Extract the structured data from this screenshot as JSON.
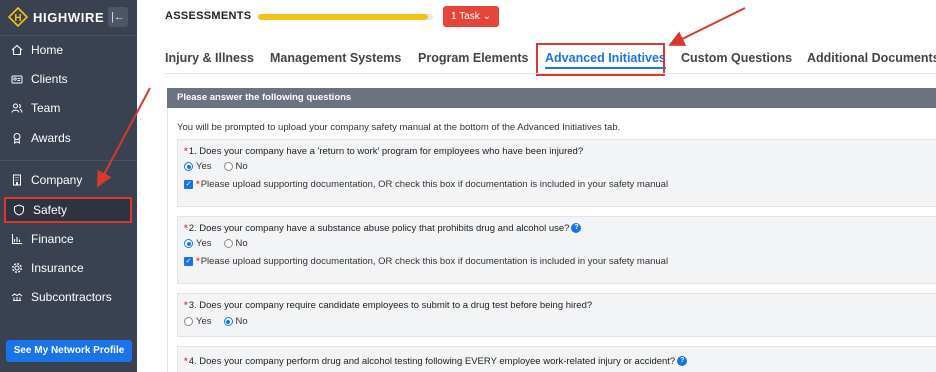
{
  "brand": {
    "name": "HIGHWIRE",
    "accent": "#f2c21b"
  },
  "sidebar": {
    "collapse_icon": "collapse-left-icon",
    "items": [
      {
        "label": "Home",
        "icon": "home-icon"
      },
      {
        "label": "Clients",
        "icon": "id-card-icon"
      },
      {
        "label": "Team",
        "icon": "team-icon"
      },
      {
        "label": "Awards",
        "icon": "award-icon"
      },
      {
        "label": "Company",
        "icon": "building-icon"
      },
      {
        "label": "Safety",
        "icon": "shield-icon"
      },
      {
        "label": "Finance",
        "icon": "bar-chart-icon"
      },
      {
        "label": "Insurance",
        "icon": "gear-icon"
      },
      {
        "label": "Subcontractors",
        "icon": "handshake-icon"
      }
    ],
    "profile_button": "See My Network Profile"
  },
  "header": {
    "title": "ASSESSMENTS",
    "progress": 0.97,
    "task_button": "1 Task"
  },
  "tabs": [
    {
      "label": "Injury & Illness",
      "active": false
    },
    {
      "label": "Management Systems",
      "active": false
    },
    {
      "label": "Program Elements",
      "active": false
    },
    {
      "label": "Advanced Initiatives",
      "active": true
    },
    {
      "label": "Custom Questions",
      "active": false
    },
    {
      "label": "Additional Documents",
      "active": false
    }
  ],
  "panel": {
    "header": "Please answer the following questions",
    "intro": "You will be prompted to upload your company safety manual at the bottom of the Advanced Initiatives tab.",
    "questions": [
      {
        "text": "1. Does your company have a 'return to work' program for employees who have been injured?",
        "yes": "Yes",
        "no": "No",
        "answer": "Yes",
        "check_text": "Please upload supporting documentation, OR check this box if documentation is included in your safety manual",
        "help": false
      },
      {
        "text": "2. Does your company have a substance abuse policy that prohibits drug and alcohol use?",
        "yes": "Yes",
        "no": "No",
        "answer": "Yes",
        "check_text": "Please upload supporting documentation, OR check this box if documentation is included in your safety manual",
        "help": true
      },
      {
        "text": "3. Does your company require candidate employees to submit to a drug test before being hired?",
        "yes": "Yes",
        "no": "No",
        "answer": "No",
        "help": false
      },
      {
        "text": "4. Does your company perform drug and alcohol testing following EVERY employee work-related injury or accident?",
        "help": true
      }
    ]
  },
  "colors": {
    "sidebar": "#3a4150",
    "primary": "#1a73e8",
    "danger": "#e4453a",
    "highlight": "#d9382c"
  }
}
